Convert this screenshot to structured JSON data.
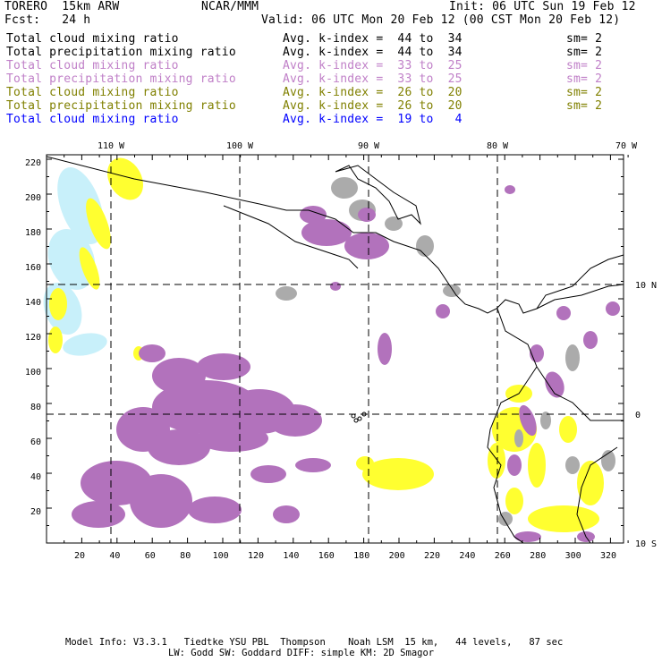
{
  "header": {
    "model": "TORERO  15km ARW",
    "org": "NCAR/MMM",
    "init": "Init: 06 UTC Sun 19 Feb 12",
    "fcst": "Fcst:   24 h",
    "valid": "Valid: 06 UTC Mon 20 Feb 12 (00 CST Mon 20 Feb 12)"
  },
  "legend": [
    {
      "field": "Total cloud mixing ratio",
      "range": "Avg. k-index =  44 to  34",
      "sm": "sm= 2",
      "color": "#000000"
    },
    {
      "field": "Total precipitation mixing ratio",
      "range": "Avg. k-index =  44 to  34",
      "sm": "sm= 2",
      "color": "#000000"
    },
    {
      "field": "Total cloud mixing ratio",
      "range": "Avg. k-index =  33 to  25",
      "sm": "sm= 2",
      "color": "#c080c8"
    },
    {
      "field": "Total precipitation mixing ratio",
      "range": "Avg. k-index =  33 to  25",
      "sm": "sm= 2",
      "color": "#c080c8"
    },
    {
      "field": "Total cloud mixing ratio",
      "range": "Avg. k-index =  26 to  20",
      "sm": "sm= 2",
      "color": "#808000"
    },
    {
      "field": "Total precipitation mixing ratio",
      "range": "Avg. k-index =  26 to  20",
      "sm": "sm= 2",
      "color": "#808000"
    },
    {
      "field": "Total cloud mixing ratio",
      "range": "Avg. k-index =  19 to   4",
      "sm": "",
      "color": "#0000ff"
    }
  ],
  "map": {
    "lon_labels": [
      "110 W",
      "100 W",
      "90 W",
      "80 W",
      "70 W"
    ],
    "lat_labels": [
      "10 N",
      "0",
      "10 S"
    ],
    "y_ticks": [
      "20",
      "40",
      "60",
      "80",
      "100",
      "120",
      "140",
      "160",
      "180",
      "200",
      "220"
    ],
    "x_ticks": [
      "20",
      "40",
      "60",
      "80",
      "100",
      "120",
      "140",
      "160",
      "180",
      "200",
      "220",
      "240",
      "260",
      "280",
      "300",
      "320"
    ],
    "colors": {
      "purple": "#b272bc",
      "gray": "#ababab",
      "yellow": "#ffff30",
      "cyan": "#c8f0fa"
    }
  },
  "footer": {
    "line1": "Model Info: V3.3.1   Tiedtke YSU PBL  Thompson    Noah LSM  15 km,   44 levels,   87 sec",
    "line2": "LW: Godd SW: Goddard DIFF: simple KM: 2D Smagor"
  }
}
